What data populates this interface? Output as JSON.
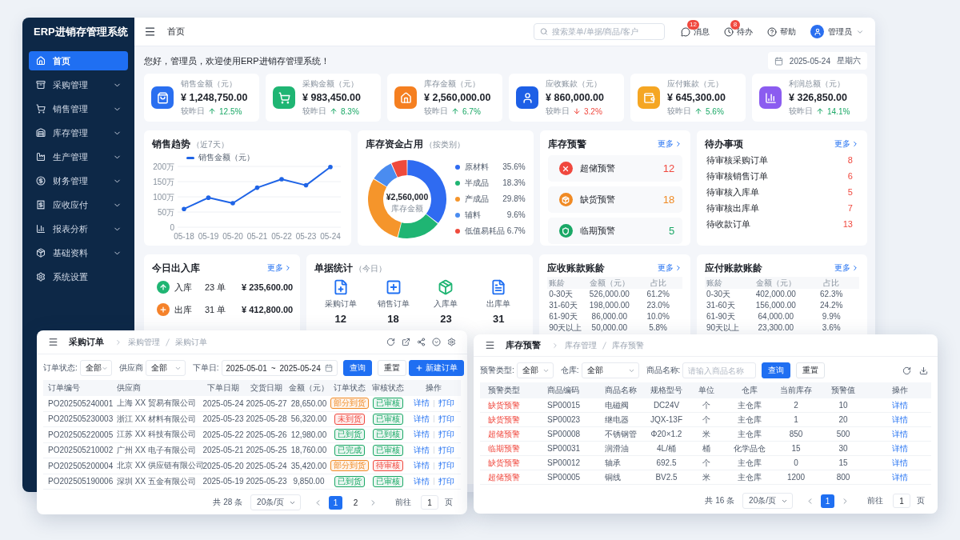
{
  "sidebar": {
    "title": "ERP进销存管理系统",
    "items": [
      {
        "label": "首页",
        "selected": true,
        "has_submenu": false
      },
      {
        "label": "采购管理",
        "selected": false,
        "has_submenu": true
      },
      {
        "label": "销售管理",
        "selected": false,
        "has_submenu": true
      },
      {
        "label": "库存管理",
        "selected": false,
        "has_submenu": true
      },
      {
        "label": "生产管理",
        "selected": false,
        "has_submenu": true
      },
      {
        "label": "财务管理",
        "selected": false,
        "has_submenu": true
      },
      {
        "label": "应收应付",
        "selected": false,
        "has_submenu": true
      },
      {
        "label": "报表分析",
        "selected": false,
        "has_submenu": true
      },
      {
        "label": "基础资料",
        "selected": false,
        "has_submenu": true
      },
      {
        "label": "系统设置",
        "selected": false,
        "has_submenu": false
      }
    ]
  },
  "topbar": {
    "page_title": "首页",
    "search": {
      "placeholder": "搜索菜单/单据/商品/客户"
    },
    "actions": [
      {
        "label": "消息",
        "badge": "12"
      },
      {
        "label": "待办",
        "badge": "8"
      },
      {
        "label": "帮助"
      }
    ],
    "user": "管理员"
  },
  "welcome": "您好，管理员，欢迎使用ERP进销存管理系统！",
  "date": {
    "value": "2025-05-24",
    "weekday": "星期六"
  },
  "stats": [
    {
      "label": "销售金额（元）",
      "value": "¥ 1,248,750.00",
      "compare": "较昨日",
      "change": "12.5%",
      "rising": true,
      "color": "#2a6ff0"
    },
    {
      "label": "采购金额（元）",
      "value": "¥ 983,450.00",
      "compare": "较昨日",
      "change": "8.3%",
      "rising": true,
      "color": "#1fb573"
    },
    {
      "label": "库存金额（元）",
      "value": "¥ 2,560,000.00",
      "compare": "较昨日",
      "change": "6.7%",
      "rising": true,
      "color": "#f57f20"
    },
    {
      "label": "应收账款（元）",
      "value": "¥ 860,000.00",
      "compare": "较昨日",
      "change": "3.2%",
      "rising": false,
      "color": "#1d5fe6"
    },
    {
      "label": "应付账款（元）",
      "value": "¥ 645,300.00",
      "compare": "较昨日",
      "change": "5.6%",
      "rising": true,
      "color": "#f5a623"
    },
    {
      "label": "利润总额（元）",
      "value": "¥ 326,850.00",
      "compare": "较昨日",
      "change": "14.1%",
      "rising": true,
      "color": "#8b5cf0"
    }
  ],
  "sales_trend": {
    "title": "销售趋势",
    "subtitle": "（近7天）",
    "chart_data": {
      "type": "line",
      "grid": true,
      "categories": [
        "05-18",
        "05-19",
        "05-20",
        "05-21",
        "05-22",
        "05-23",
        "05-24"
      ],
      "series": [
        {
          "name": "销售金额（元）",
          "color": "#1f64e6",
          "values": [
            60,
            97,
            79,
            130,
            158,
            138,
            198
          ]
        }
      ],
      "ylim": [
        0,
        200
      ],
      "yticks": [
        {
          "value": 0,
          "label": "0"
        },
        {
          "value": 50,
          "label": "50万"
        },
        {
          "value": 100,
          "label": "100万"
        },
        {
          "value": 150,
          "label": "150万"
        },
        {
          "value": 200,
          "label": "200万"
        }
      ]
    }
  },
  "inventory_capital": {
    "title": "库存资金占用",
    "subtitle": "（按类别）",
    "center_value": "¥2,560,000",
    "center_label": "库存金额",
    "chart_data": {
      "type": "donut",
      "categories": [
        "原材料",
        "半成品",
        "产成品",
        "辅料",
        "低值易耗品"
      ],
      "values": [
        35.6,
        18.3,
        29.8,
        9.6,
        6.7
      ],
      "value_labels": [
        "35.6%",
        "18.3%",
        "29.8%",
        "9.6%",
        "6.7%"
      ],
      "colors": [
        "#2f6bf1",
        "#1fb573",
        "#f5952b",
        "#4a8cf0",
        "#ef4a3c"
      ]
    }
  },
  "stock_alerts": {
    "title": "库存预警",
    "more": "更多",
    "items": [
      {
        "label": "超储预警",
        "count": "12",
        "color": "#f0483e"
      },
      {
        "label": "缺货预警",
        "count": "18",
        "color": "#f08a24"
      },
      {
        "label": "临期预警",
        "count": "5",
        "color": "#1aa866"
      }
    ]
  },
  "todos": {
    "title": "待办事项",
    "more": "更多",
    "items": [
      {
        "label": "待审核采购订单",
        "count": "8"
      },
      {
        "label": "待审核销售订单",
        "count": "6"
      },
      {
        "label": "待审核入库单",
        "count": "5"
      },
      {
        "label": "待审核出库单",
        "count": "7"
      },
      {
        "label": "待收款订单",
        "count": "13"
      }
    ]
  },
  "today_io": {
    "title": "今日出入库",
    "more": "更多",
    "items": [
      {
        "kind": "inbound",
        "label": "入库",
        "count": "23 单",
        "amount": "¥ 235,600.00"
      },
      {
        "kind": "outbound",
        "label": "出库",
        "count": "31 单",
        "amount": "¥ 412,800.00"
      }
    ]
  },
  "documents": {
    "title": "单据统计",
    "subtitle": "（今日）",
    "items": [
      {
        "label": "采购订单",
        "count": "12"
      },
      {
        "label": "销售订单",
        "count": "18"
      },
      {
        "label": "入库单",
        "count": "23"
      },
      {
        "label": "出库单",
        "count": "31"
      }
    ]
  },
  "receivable_aging": {
    "title": "应收账款账龄",
    "more": "更多",
    "columns": [
      "账龄",
      "金额（元）",
      "占比"
    ],
    "rows": [
      [
        "0-30天",
        "526,000.00",
        "61.2%"
      ],
      [
        "31-60天",
        "198,000.00",
        "23.0%"
      ],
      [
        "61-90天",
        "86,000.00",
        "10.0%"
      ],
      [
        "90天以上",
        "50,000.00",
        "5.8%"
      ]
    ]
  },
  "payable_aging": {
    "title": "应付账款账龄",
    "more": "更多",
    "columns": [
      "账龄",
      "金额（元）",
      "占比"
    ],
    "rows": [
      [
        "0-30天",
        "402,000.00",
        "62.3%"
      ],
      [
        "31-60天",
        "156,000.00",
        "24.2%"
      ],
      [
        "61-90天",
        "64,000.00",
        "9.9%"
      ],
      [
        "90天以上",
        "23,300.00",
        "3.6%"
      ]
    ]
  },
  "purchase_orders": {
    "title": "采购订单",
    "breadcrumb": [
      "采购管理",
      "采购订单"
    ],
    "filters": [
      {
        "label": "订单状态:",
        "value": "全部"
      },
      {
        "label": "供应商",
        "value": "全部"
      }
    ],
    "date_filter": {
      "label": "下单日:",
      "start": "2025-05-01",
      "separator": "~",
      "end": "2025-05-24"
    },
    "buttons": [
      {
        "label": "查询",
        "primary": true
      },
      {
        "label": "重置",
        "primary": false
      }
    ],
    "create_button": "新建订单",
    "columns": [
      "订单编号",
      "供应商",
      "下单日期",
      "交货日期",
      "金额（元）",
      "订单状态",
      "审核状态",
      "操作"
    ],
    "rows": [
      {
        "order_no": "PO202505240001",
        "supplier": "上海 XX 贸易有限公司",
        "order_date": "2025-05-24",
        "delivery_date": "2025-05-27",
        "amount": "28,650.00",
        "order_status": {
          "text": "部分到货",
          "color": "#f08a24"
        },
        "review_status": {
          "text": "已审核",
          "color": "#1aa866"
        },
        "actions": [
          "详情",
          "打印"
        ]
      },
      {
        "order_no": "PO202505230003",
        "supplier": "浙江 XX 材料有限公司",
        "order_date": "2025-05-23",
        "delivery_date": "2025-05-28",
        "amount": "56,320.00",
        "order_status": {
          "text": "未到货",
          "color": "#f0483e"
        },
        "review_status": {
          "text": "已审核",
          "color": "#1aa866"
        },
        "actions": [
          "详情",
          "打印"
        ]
      },
      {
        "order_no": "PO202505220005",
        "supplier": "江苏 XX 科技有限公司",
        "order_date": "2025-05-22",
        "delivery_date": "2025-05-26",
        "amount": "12,980.00",
        "order_status": {
          "text": "已到货",
          "color": "#1aa866"
        },
        "review_status": {
          "text": "已到核",
          "color": "#1aa866"
        },
        "actions": [
          "详情",
          "打印"
        ]
      },
      {
        "order_no": "PO202505210002",
        "supplier": "广州 XX 电子有限公司",
        "order_date": "2025-05-21",
        "delivery_date": "2025-05-25",
        "amount": "18,760.00",
        "order_status": {
          "text": "已完成",
          "color": "#1aa866"
        },
        "review_status": {
          "text": "已审核",
          "color": "#1aa866"
        },
        "actions": [
          "详情",
          "打印"
        ]
      },
      {
        "order_no": "PO202505200004",
        "supplier": "北京 XX 供应链有限公司",
        "order_date": "2025-05-20",
        "delivery_date": "2025-05-24",
        "amount": "35,420.00",
        "order_status": {
          "text": "部分到货",
          "color": "#f08a24"
        },
        "review_status": {
          "text": "待审核",
          "color": "#f0483e"
        },
        "actions": [
          "详情",
          "打印"
        ]
      },
      {
        "order_no": "PO202505190006",
        "supplier": "深圳 XX 五金有限公司",
        "order_date": "2025-05-19",
        "delivery_date": "2025-05-23",
        "amount": "9,850.00",
        "order_status": {
          "text": "已到货",
          "color": "#1aa866"
        },
        "review_status": {
          "text": "已审核",
          "color": "#1aa866"
        },
        "actions": [
          "详情",
          "打印"
        ]
      }
    ],
    "pagination": {
      "total": "共 28 条",
      "page_size": "20条/页",
      "pages": [
        {
          "label": "1",
          "selected": true
        },
        {
          "label": "2",
          "selected": false
        }
      ],
      "goto_label": "前往",
      "goto_value": "1",
      "page_suffix": "页"
    }
  },
  "stock_warnings": {
    "title": "库存预警",
    "breadcrumb": [
      "库存管理",
      "库存预警"
    ],
    "filters": [
      {
        "label": "预警类型:",
        "value": "全部"
      },
      {
        "label": "仓库:",
        "value": "全部"
      }
    ],
    "name_filter": {
      "label": "商品名称:",
      "placeholder": "请输入商品名称"
    },
    "buttons": [
      {
        "label": "查询",
        "primary": true
      },
      {
        "label": "重置",
        "primary": false
      }
    ],
    "columns": [
      "预警类型",
      "商品编码",
      "商品名称",
      "规格型号",
      "单位",
      "仓库",
      "当前库存",
      "预警值",
      "操作"
    ],
    "rows": [
      {
        "type": "缺货预警",
        "code": "SP00015",
        "name": "电磁阀",
        "spec": "DC24V",
        "unit": "个",
        "warehouse": "主仓库",
        "stock": "2",
        "threshold": "10",
        "action": "详情"
      },
      {
        "type": "缺货预警",
        "code": "SP00023",
        "name": "继电器",
        "spec": "JQX-13F",
        "unit": "个",
        "warehouse": "主仓库",
        "stock": "1",
        "threshold": "20",
        "action": "详情"
      },
      {
        "type": "超储预警",
        "code": "SP00008",
        "name": "不锈钢管",
        "spec": "Φ20×1.2",
        "unit": "米",
        "warehouse": "主仓库",
        "stock": "850",
        "threshold": "500",
        "action": "详情"
      },
      {
        "type": "临期预警",
        "code": "SP00031",
        "name": "润滑油",
        "spec": "4L/桶",
        "unit": "桶",
        "warehouse": "化学品仓",
        "stock": "15",
        "threshold": "30",
        "action": "详情"
      },
      {
        "type": "缺货预警",
        "code": "SP00012",
        "name": "轴承",
        "spec": "692.5",
        "unit": "个",
        "warehouse": "主仓库",
        "stock": "0",
        "threshold": "15",
        "action": "详情"
      },
      {
        "type": "超储预警",
        "code": "SP00005",
        "name": "铜线",
        "spec": "BV2.5",
        "unit": "米",
        "warehouse": "主仓库",
        "stock": "1200",
        "threshold": "800",
        "action": "详情"
      }
    ],
    "pagination": {
      "total": "共 16 条",
      "page_size": "20条/页",
      "pages": [
        {
          "label": "1",
          "selected": true
        }
      ],
      "goto_label": "前往",
      "goto_value": "1",
      "page_suffix": "页"
    }
  }
}
